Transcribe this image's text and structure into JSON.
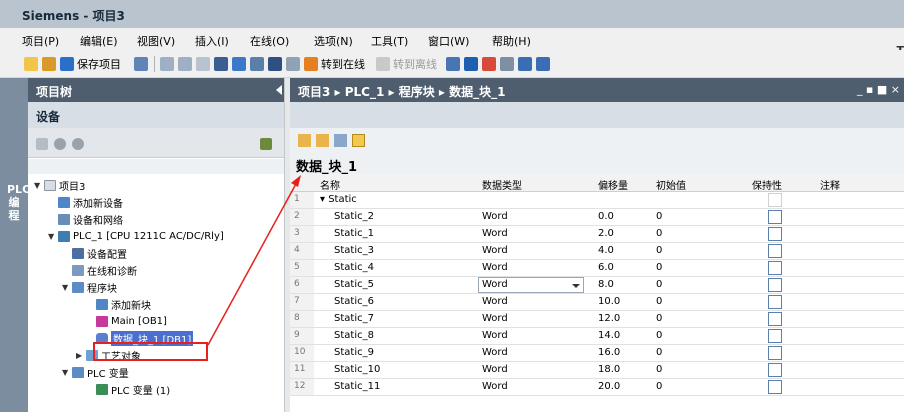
{
  "window": {
    "title": "Siemens - 项目3"
  },
  "menu": {
    "items": [
      "项目(P)",
      "编辑(E)",
      "视图(V)",
      "插入(I)",
      "在线(O)",
      "选项(N)",
      "工具(T)",
      "窗口(W)",
      "帮助(H)"
    ],
    "right_text": "T"
  },
  "toolbar": {
    "save_label": "保存项目",
    "go_online_label": "转到在线",
    "go_offline_label": "转到离线"
  },
  "side_strip": {
    "label": "PLC编程"
  },
  "project_tree": {
    "title": "项目树",
    "devices_tab": "设备",
    "items": [
      {
        "label": "项目3"
      },
      {
        "label": "添加新设备"
      },
      {
        "label": "设备和网络"
      },
      {
        "label": "PLC_1 [CPU 1211C AC/DC/Rly]"
      },
      {
        "label": "设备配置"
      },
      {
        "label": "在线和诊断"
      },
      {
        "label": "程序块"
      },
      {
        "label": "添加新块"
      },
      {
        "label": "Main [OB1]"
      },
      {
        "label": "数据_块_1 [DB1]"
      },
      {
        "label": "工艺对象"
      },
      {
        "label": "PLC 变量"
      },
      {
        "label": "PLC 变量 (1)"
      }
    ]
  },
  "editor": {
    "breadcrumb": "项目3 ▸ PLC_1 ▸ 程序块 ▸ 数据_块_1",
    "window_buttons": "_ ▪ ■ ×",
    "block_title": "数据_块_1",
    "columns": [
      "名称",
      "数据类型",
      "偏移量",
      "初始值",
      "保持性",
      "注释"
    ],
    "rows": [
      {
        "num": "1",
        "name": "Static",
        "type": "",
        "offset": "",
        "init": ""
      },
      {
        "num": "2",
        "name": "Static_2",
        "type": "Word",
        "offset": "0.0",
        "init": "0"
      },
      {
        "num": "3",
        "name": "Static_1",
        "type": "Word",
        "offset": "2.0",
        "init": "0"
      },
      {
        "num": "4",
        "name": "Static_3",
        "type": "Word",
        "offset": "4.0",
        "init": "0"
      },
      {
        "num": "5",
        "name": "Static_4",
        "type": "Word",
        "offset": "6.0",
        "init": "0"
      },
      {
        "num": "6",
        "name": "Static_5",
        "type": "Word",
        "offset": "8.0",
        "init": "0"
      },
      {
        "num": "7",
        "name": "Static_6",
        "type": "Word",
        "offset": "10.0",
        "init": "0"
      },
      {
        "num": "8",
        "name": "Static_7",
        "type": "Word",
        "offset": "12.0",
        "init": "0"
      },
      {
        "num": "9",
        "name": "Static_8",
        "type": "Word",
        "offset": "14.0",
        "init": "0"
      },
      {
        "num": "10",
        "name": "Static_9",
        "type": "Word",
        "offset": "16.0",
        "init": "0"
      },
      {
        "num": "11",
        "name": "Static_10",
        "type": "Word",
        "offset": "18.0",
        "init": "0"
      },
      {
        "num": "12",
        "name": "Static_11",
        "type": "Word",
        "offset": "20.0",
        "init": "0"
      }
    ]
  },
  "colors": {
    "title_bar": "#b9c4cf",
    "panel_header": "#4f5e6e",
    "selection": "#4a6fd1",
    "annotation_red": "#e8201c"
  }
}
